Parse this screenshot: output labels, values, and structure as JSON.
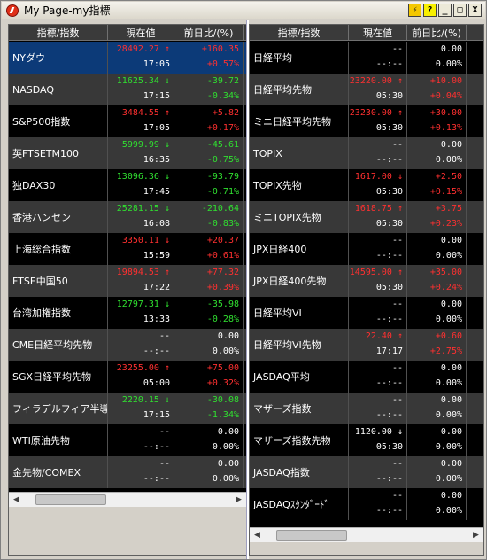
{
  "window": {
    "title": "My Page-my指標"
  },
  "titlebar_buttons": {
    "link": "⚡",
    "help": "?",
    "minimize": "_",
    "maximize": "□",
    "close": "X"
  },
  "left_panel": {
    "headers": [
      "指標/指数",
      "現在値",
      "前日比/(%)"
    ],
    "rows": [
      {
        "name": "NYダウ",
        "value": "28492.27 ↑",
        "time": "17:05",
        "change": "+160.35",
        "pct": "+0.57%",
        "dir": "up",
        "selected": true
      },
      {
        "name": "NASDAQ",
        "value": "11625.34 ↓",
        "time": "17:15",
        "change": "-39.72",
        "pct": "-0.34%",
        "dir": "down"
      },
      {
        "name": "S&P500指数",
        "value": "3484.55 ↑",
        "time": "17:05",
        "change": "+5.82",
        "pct": "+0.17%",
        "dir": "up"
      },
      {
        "name": "英FTSETM100",
        "value": "5999.99 ↓",
        "time": "16:35",
        "change": "-45.61",
        "pct": "-0.75%",
        "dir": "down"
      },
      {
        "name": "独DAX30",
        "value": "13096.36 ↓",
        "time": "17:45",
        "change": "-93.79",
        "pct": "-0.71%",
        "dir": "down"
      },
      {
        "name": "香港ハンセン",
        "value": "25281.15 ↓",
        "time": "16:08",
        "change": "-210.64",
        "pct": "-0.83%",
        "dir": "down"
      },
      {
        "name": "上海総合指数",
        "value": "3350.11 ↓",
        "time": "15:59",
        "change": "+20.37",
        "pct": "+0.61%",
        "dir": "up"
      },
      {
        "name": "FTSE中国50",
        "value": "19894.53 ↑",
        "time": "17:22",
        "change": "+77.32",
        "pct": "+0.39%",
        "dir": "up"
      },
      {
        "name": "台湾加権指数",
        "value": "12797.31 ↓",
        "time": "13:33",
        "change": "-35.98",
        "pct": "-0.28%",
        "dir": "down"
      },
      {
        "name": "CME日経平均先物",
        "value": "--",
        "time": "--:--",
        "change": "0.00",
        "pct": "0.00%",
        "dir": "flat"
      },
      {
        "name": "SGX日経平均先物",
        "value": "23255.00 ↑",
        "time": "05:00",
        "change": "+75.00",
        "pct": "+0.32%",
        "dir": "up"
      },
      {
        "name": "フィラデルフィア半導体",
        "value": "2220.15 ↓",
        "time": "17:15",
        "change": "-30.08",
        "pct": "-1.34%",
        "dir": "down"
      },
      {
        "name": "WTI原油先物",
        "value": "--",
        "time": "--:--",
        "change": "0.00",
        "pct": "0.00%",
        "dir": "flat"
      },
      {
        "name": "金先物/COMEX",
        "value": "--",
        "time": "--:--",
        "change": "0.00",
        "pct": "0.00%",
        "dir": "flat"
      }
    ]
  },
  "right_panel": {
    "headers": [
      "指標/指数",
      "現在値",
      "前日比/(%)"
    ],
    "rows": [
      {
        "name": "日経平均",
        "value": "--",
        "time": "--:--",
        "change": "0.00",
        "pct": "0.00%",
        "dir": "flat"
      },
      {
        "name": "日経平均先物",
        "value": "23220.00 ↑",
        "time": "05:30",
        "change": "+10.00",
        "pct": "+0.04%",
        "dir": "up"
      },
      {
        "name": "ミニ日経平均先物",
        "value": "23230.00 ↑",
        "time": "05:30",
        "change": "+30.00",
        "pct": "+0.13%",
        "dir": "up"
      },
      {
        "name": "TOPIX",
        "value": "--",
        "time": "--:--",
        "change": "0.00",
        "pct": "0.00%",
        "dir": "flat"
      },
      {
        "name": "TOPIX先物",
        "value": "1617.00 ↓",
        "time": "05:30",
        "change": "+2.50",
        "pct": "+0.15%",
        "dir": "up"
      },
      {
        "name": "ミニTOPIX先物",
        "value": "1618.75 ↑",
        "time": "05:30",
        "change": "+3.75",
        "pct": "+0.23%",
        "dir": "up"
      },
      {
        "name": "JPX日経400",
        "value": "--",
        "time": "--:--",
        "change": "0.00",
        "pct": "0.00%",
        "dir": "flat"
      },
      {
        "name": "JPX日経400先物",
        "value": "14595.00 ↑",
        "time": "05:30",
        "change": "+35.00",
        "pct": "+0.24%",
        "dir": "up"
      },
      {
        "name": "日経平均VI",
        "value": "--",
        "time": "--:--",
        "change": "0.00",
        "pct": "0.00%",
        "dir": "flat"
      },
      {
        "name": "日経平均VI先物",
        "value": "22.40 ↑",
        "time": "17:17",
        "change": "+0.60",
        "pct": "+2.75%",
        "dir": "up"
      },
      {
        "name": "JASDAQ平均",
        "value": "--",
        "time": "--:--",
        "change": "0.00",
        "pct": "0.00%",
        "dir": "flat"
      },
      {
        "name": "マザーズ指数",
        "value": "--",
        "time": "--:--",
        "change": "0.00",
        "pct": "0.00%",
        "dir": "flat"
      },
      {
        "name": "マザーズ指数先物",
        "value": "1120.00 ↓",
        "time": "05:30",
        "change": "0.00",
        "pct": "0.00%",
        "dir": "flat"
      },
      {
        "name": "JASDAQ指数",
        "value": "--",
        "time": "--:--",
        "change": "0.00",
        "pct": "0.00%",
        "dir": "flat"
      },
      {
        "name": "JASDAQｽﾀﾝﾀﾞｰﾄﾞ",
        "value": "--",
        "time": "--:--",
        "change": "0.00",
        "pct": "0.00%",
        "dir": "flat"
      }
    ]
  },
  "scrollbar": {
    "left_arrow": "◀",
    "right_arrow": "▶"
  },
  "colors": {
    "up": "#ff3030",
    "down": "#30e030",
    "flat": "#ffffff",
    "selected_row": "#0c3a78"
  }
}
